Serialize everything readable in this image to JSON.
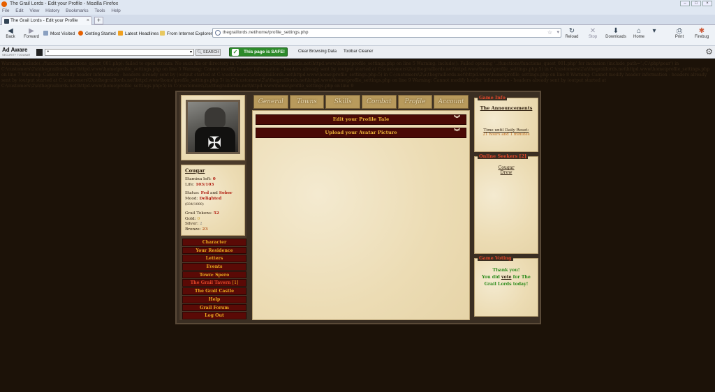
{
  "window": {
    "title": "The Grail Lords - Edit your Profile - Mozilla Firefox"
  },
  "menubar": [
    "File",
    "Edit",
    "View",
    "History",
    "Bookmarks",
    "Tools",
    "Help"
  ],
  "tab": {
    "label": "The Grail Lords - Edit your Profile",
    "close": "×",
    "new": "+"
  },
  "nav": {
    "back": "Back",
    "forward": "Forward",
    "bookmarks": [
      "Most Visited",
      "Getting Started",
      "Latest Headlines",
      "From Internet Explorer"
    ],
    "url": "thegraillords.net/home/profile_settings.php",
    "reload": "Reload",
    "stop": "Stop",
    "downloads": "Downloads",
    "home": "Home",
    "print": "Print",
    "firebug": "Firebug"
  },
  "adaware": {
    "logo": "Ad Aware",
    "tagline": "SECURITY TOOLBAR",
    "search_btn": "SEARCH",
    "safe": "This page is SAFE!",
    "clear": "Clear Browsing Data",
    "cleaner": "Toolbar Cleaner"
  },
  "warning_text": "Warning: include(../functions/functions_quest_001.php): failed to open stream: No such file or directory in C:\\customers\\2\\a\\thegraillords.net\\httpd.www\\home\\profile_settings.php on line 5 Warning: include(): Failed opening '../functions/functions_quest_001.php' for inclusion (include_path='.;C:\\php\\pear') in C:\\customers\\2\\a\\thegraillords.net\\httpd.www\\home\\profile_settings.php on line 5 Warning: Cannot modify header information - headers already sent by (output started at C:\\customers\\2\\a\\thegraillords.net\\httpd.www\\home\\profile_settings.php:5) in C:\\customers\\2\\a\\thegraillords.net\\httpd.www\\home\\profile_settings.php on line 7 Warning: Cannot modify header information - headers already sent by (output started at C:\\customers\\2\\a\\thegraillords.net\\httpd.www\\home\\profile_settings.php:5) in C:\\customers\\2\\a\\thegraillords.net\\httpd.www\\home\\profile_settings.php on line 8 Warning: Cannot modify header information - headers already sent by (output started at C:\\customers\\2\\a\\thegraillords.net\\httpd.www\\home\\profile_settings.php:5) in C:\\customers\\2\\a\\thegraillords.net\\httpd.www\\home\\profile_settings.php on line 9 Warning: Cannot modify header information - headers already sent by (output started at C:\\customers\\2\\a\\thegraillords.net\\httpd.www\\home\\profile_settings.php:5) in C:\\customers\\2\\a\\thegraillords.net\\httpd.www\\home\\profile_settings.php on line 9",
  "player": {
    "name": "Cougar",
    "stamina_label": "Stamina left:",
    "stamina": "0",
    "life_label": "Life:",
    "life": "103/103",
    "status_label": "Status:",
    "status1": "Fed",
    "status_and": "and",
    "status2": "Sober",
    "mood_label": "Mood:",
    "mood": "Delighted",
    "mood_val": "(834/1000)",
    "tokens_label": "Grail Tokens:",
    "tokens": "52",
    "gold_label": "Gold:",
    "gold": "0",
    "silver_label": "Silver:",
    "silver": "2",
    "bronze_label": "Bronze:",
    "bronze": "23"
  },
  "menu": [
    "Character",
    "Your Residence",
    "Letters",
    "Events",
    "Town: Spero",
    "The Grail Tavern",
    "The Grail Castle",
    "Help",
    "Grail Forum",
    "Log Out"
  ],
  "menu_tavern_count": "[1]",
  "tabs": [
    "General",
    "Towns",
    "Skills",
    "Combat",
    "Profile",
    "Account"
  ],
  "panels": {
    "tale": "Edit your Profile Tale",
    "avatar": "Upload your Avatar Picture",
    "chev": "»"
  },
  "game_info": {
    "legend": "Game Info",
    "announcements": "The Announcements",
    "reset_label": "Time until Daily Reset:",
    "reset_value": "21 hours and 1 minutes"
  },
  "seekers": {
    "legend": "Online Seekers [2]",
    "names": [
      "Cougar",
      "Drew"
    ]
  },
  "voting": {
    "legend": "Game Voting",
    "line1": "Thank you!",
    "line2a": "You did",
    "vote": "vote",
    "line2b": "for The",
    "line3": "Grail Lords today!"
  },
  "colors": {
    "page_bg": "#1c1208",
    "menu_bg": "#5a0a06",
    "menu_text": "#e8a81e",
    "accent_red": "#e0462a",
    "safe_green": "#2c8a2a"
  }
}
